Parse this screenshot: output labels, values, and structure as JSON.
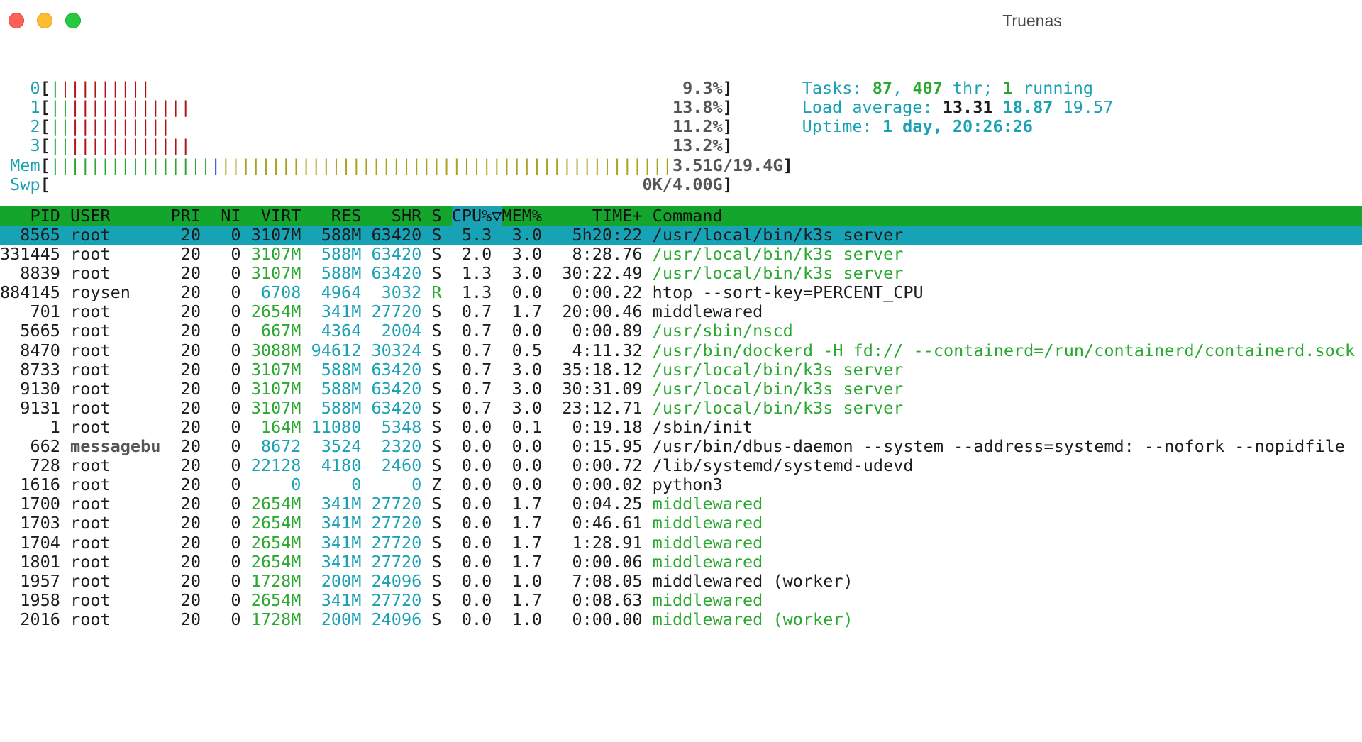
{
  "window": {
    "title": "Truenas"
  },
  "meters": {
    "cpus": [
      {
        "label": "0",
        "bars": 10,
        "green": 1,
        "value": "9.3%"
      },
      {
        "label": "1",
        "bars": 14,
        "green": 2,
        "value": "13.8%"
      },
      {
        "label": "2",
        "bars": 12,
        "green": 2,
        "value": "11.2%"
      },
      {
        "label": "3",
        "bars": 14,
        "green": 2,
        "value": "13.2%"
      }
    ],
    "mem": {
      "label": "Mem",
      "used_bars": 16,
      "buffer_bars": 1,
      "cache_bars": 45,
      "value": "3.51G/19.4G"
    },
    "swp": {
      "label": "Swp",
      "value": "0K/4.00G"
    }
  },
  "summary": {
    "tasks_label": "Tasks: ",
    "tasks": "87",
    "sep1": ", ",
    "threads": "407",
    "thr_label": " thr; ",
    "running": "1",
    "running_label": " running",
    "load_label": "Load average: ",
    "load1": "13.31",
    "load5": "18.87",
    "load15": "19.57",
    "uptime_label": "Uptime: ",
    "uptime": "1 day, 20:26:26"
  },
  "columns": {
    "pid": "PID",
    "user": "USER",
    "pri": "PRI",
    "ni": "NI",
    "virt": "VIRT",
    "res": "RES",
    "shr": "SHR",
    "s": "S",
    "cpu": "CPU%▽",
    "mem": "MEM%",
    "time": "TIME+",
    "command": "Command"
  },
  "processes": [
    {
      "pid": "8565",
      "user": "root",
      "pri": "20",
      "ni": "0",
      "virt": "3107M",
      "res": "588M",
      "shr": "63420",
      "s": "S",
      "cpu": "5.3",
      "mem": "3.0",
      "time": "5h20:22",
      "command": "/usr/local/bin/k3s server",
      "selected": true,
      "thread": false
    },
    {
      "pid": "331445",
      "user": "root",
      "pri": "20",
      "ni": "0",
      "virt": "3107M",
      "res": "588M",
      "shr": "63420",
      "s": "S",
      "cpu": "2.0",
      "mem": "3.0",
      "time": "8:28.76",
      "command": "/usr/local/bin/k3s server",
      "thread": true
    },
    {
      "pid": "8839",
      "user": "root",
      "pri": "20",
      "ni": "0",
      "virt": "3107M",
      "res": "588M",
      "shr": "63420",
      "s": "S",
      "cpu": "1.3",
      "mem": "3.0",
      "time": "30:22.49",
      "command": "/usr/local/bin/k3s server",
      "thread": true
    },
    {
      "pid": "884145",
      "user": "roysen",
      "pri": "20",
      "ni": "0",
      "virt": "6708",
      "res": "4964",
      "shr": "3032",
      "s": "R",
      "cpu": "1.3",
      "mem": "0.0",
      "time": "0:00.22",
      "command": "htop --sort-key=PERCENT_CPU",
      "thread": false
    },
    {
      "pid": "701",
      "user": "root",
      "pri": "20",
      "ni": "0",
      "virt": "2654M",
      "res": "341M",
      "shr": "27720",
      "s": "S",
      "cpu": "0.7",
      "mem": "1.7",
      "time": "20:00.46",
      "command": "middlewared",
      "thread": false
    },
    {
      "pid": "5665",
      "user": "root",
      "pri": "20",
      "ni": "0",
      "virt": "667M",
      "res": "4364",
      "shr": "2004",
      "s": "S",
      "cpu": "0.7",
      "mem": "0.0",
      "time": "0:00.89",
      "command": "/usr/sbin/nscd",
      "thread": true
    },
    {
      "pid": "8470",
      "user": "root",
      "pri": "20",
      "ni": "0",
      "virt": "3088M",
      "res": "94612",
      "shr": "30324",
      "s": "S",
      "cpu": "0.7",
      "mem": "0.5",
      "time": "4:11.32",
      "command": "/usr/bin/dockerd -H fd:// --containerd=/run/containerd/containerd.sock",
      "thread": true
    },
    {
      "pid": "8733",
      "user": "root",
      "pri": "20",
      "ni": "0",
      "virt": "3107M",
      "res": "588M",
      "shr": "63420",
      "s": "S",
      "cpu": "0.7",
      "mem": "3.0",
      "time": "35:18.12",
      "command": "/usr/local/bin/k3s server",
      "thread": true
    },
    {
      "pid": "9130",
      "user": "root",
      "pri": "20",
      "ni": "0",
      "virt": "3107M",
      "res": "588M",
      "shr": "63420",
      "s": "S",
      "cpu": "0.7",
      "mem": "3.0",
      "time": "30:31.09",
      "command": "/usr/local/bin/k3s server",
      "thread": true
    },
    {
      "pid": "9131",
      "user": "root",
      "pri": "20",
      "ni": "0",
      "virt": "3107M",
      "res": "588M",
      "shr": "63420",
      "s": "S",
      "cpu": "0.7",
      "mem": "3.0",
      "time": "23:12.71",
      "command": "/usr/local/bin/k3s server",
      "thread": true
    },
    {
      "pid": "1",
      "user": "root",
      "pri": "20",
      "ni": "0",
      "virt": "164M",
      "res": "11080",
      "shr": "5348",
      "s": "S",
      "cpu": "0.0",
      "mem": "0.1",
      "time": "0:19.18",
      "command": "/sbin/init",
      "thread": false
    },
    {
      "pid": "662",
      "user": "messagebu",
      "pri": "20",
      "ni": "0",
      "virt": "8672",
      "res": "3524",
      "shr": "2320",
      "s": "S",
      "cpu": "0.0",
      "mem": "0.0",
      "time": "0:15.95",
      "command": "/usr/bin/dbus-daemon --system --address=systemd: --nofork --nopidfile",
      "thread": false
    },
    {
      "pid": "728",
      "user": "root",
      "pri": "20",
      "ni": "0",
      "virt": "22128",
      "res": "4180",
      "shr": "2460",
      "s": "S",
      "cpu": "0.0",
      "mem": "0.0",
      "time": "0:00.72",
      "command": "/lib/systemd/systemd-udevd",
      "thread": false
    },
    {
      "pid": "1616",
      "user": "root",
      "pri": "20",
      "ni": "0",
      "virt": "0",
      "res": "0",
      "shr": "0",
      "s": "Z",
      "cpu": "0.0",
      "mem": "0.0",
      "time": "0:00.02",
      "command": "python3",
      "thread": false
    },
    {
      "pid": "1700",
      "user": "root",
      "pri": "20",
      "ni": "0",
      "virt": "2654M",
      "res": "341M",
      "shr": "27720",
      "s": "S",
      "cpu": "0.0",
      "mem": "1.7",
      "time": "0:04.25",
      "command": "middlewared",
      "thread": true
    },
    {
      "pid": "1703",
      "user": "root",
      "pri": "20",
      "ni": "0",
      "virt": "2654M",
      "res": "341M",
      "shr": "27720",
      "s": "S",
      "cpu": "0.0",
      "mem": "1.7",
      "time": "0:46.61",
      "command": "middlewared",
      "thread": true
    },
    {
      "pid": "1704",
      "user": "root",
      "pri": "20",
      "ni": "0",
      "virt": "2654M",
      "res": "341M",
      "shr": "27720",
      "s": "S",
      "cpu": "0.0",
      "mem": "1.7",
      "time": "1:28.91",
      "command": "middlewared",
      "thread": true
    },
    {
      "pid": "1801",
      "user": "root",
      "pri": "20",
      "ni": "0",
      "virt": "2654M",
      "res": "341M",
      "shr": "27720",
      "s": "S",
      "cpu": "0.0",
      "mem": "1.7",
      "time": "0:00.06",
      "command": "middlewared",
      "thread": true
    },
    {
      "pid": "1957",
      "user": "root",
      "pri": "20",
      "ni": "0",
      "virt": "1728M",
      "res": "200M",
      "shr": "24096",
      "s": "S",
      "cpu": "0.0",
      "mem": "1.0",
      "time": "7:08.05",
      "command": "middlewared (worker)",
      "thread": false
    },
    {
      "pid": "1958",
      "user": "root",
      "pri": "20",
      "ni": "0",
      "virt": "2654M",
      "res": "341M",
      "shr": "27720",
      "s": "S",
      "cpu": "0.0",
      "mem": "1.7",
      "time": "0:08.63",
      "command": "middlewared",
      "thread": true
    },
    {
      "pid": "2016",
      "user": "root",
      "pri": "20",
      "ni": "0",
      "virt": "1728M",
      "res": "200M",
      "shr": "24096",
      "s": "S",
      "cpu": "0.0",
      "mem": "1.0",
      "time": "0:00.00",
      "command": "middlewared (worker)",
      "thread": true
    }
  ],
  "colors": {
    "cyan": "#1aa1b3",
    "green": "#2aa830",
    "red": "#b21414",
    "olive": "#a9a31c",
    "blue": "#2b31c9",
    "header_bg": "#14a52c",
    "selected_bg": "#15a3b5"
  }
}
